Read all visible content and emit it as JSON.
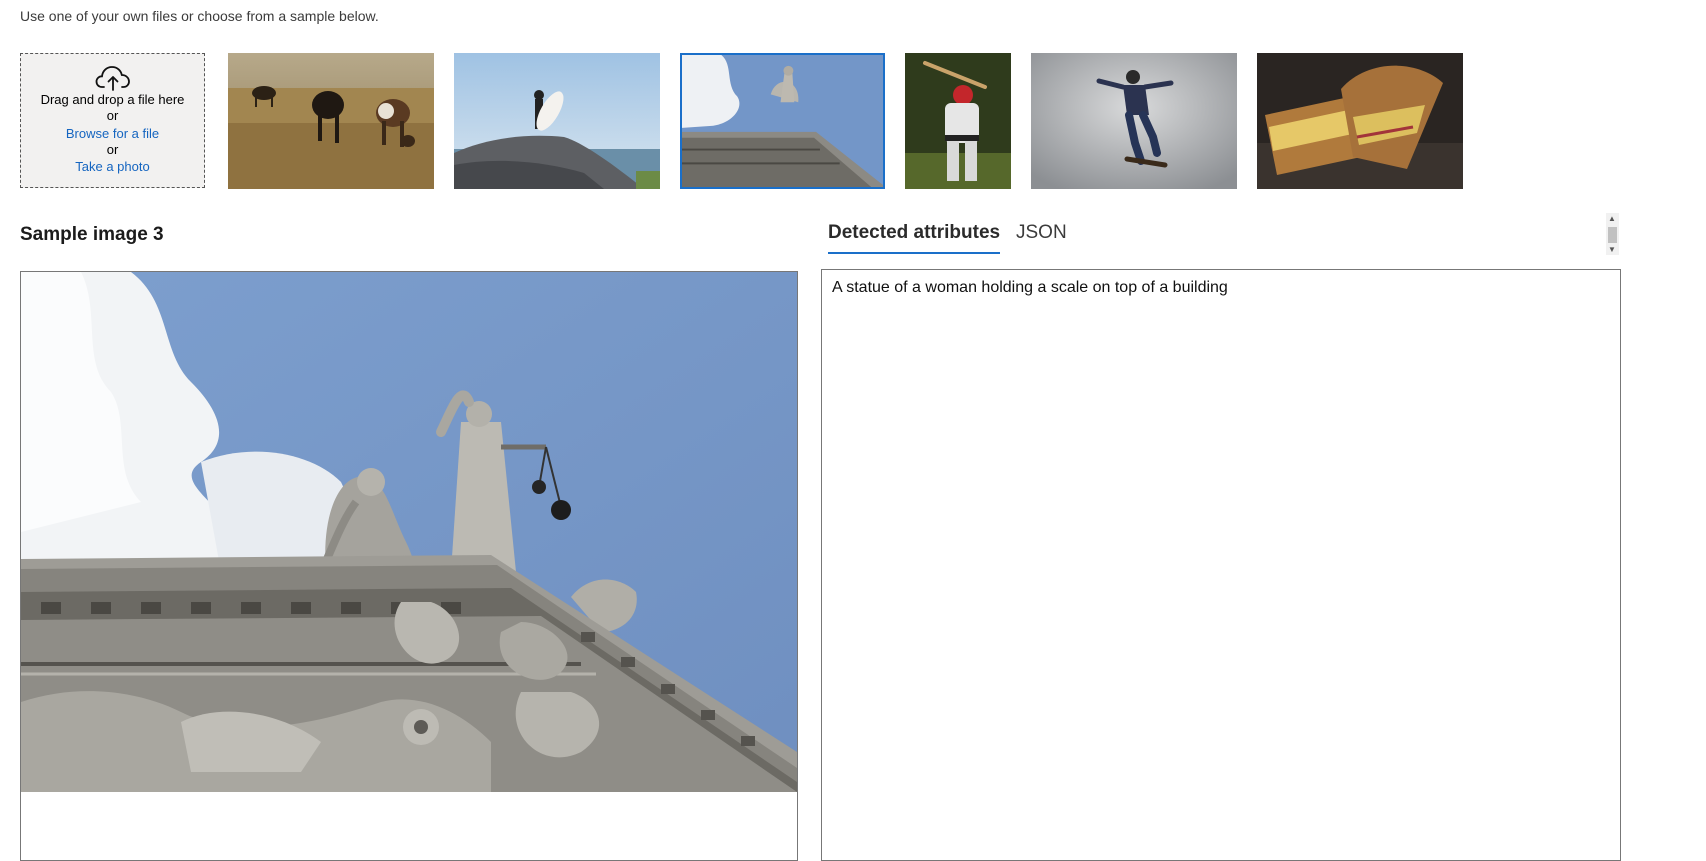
{
  "intro_text": "Use one of your own files or choose from a sample below.",
  "upload": {
    "drag_text": "Drag and drop a file here",
    "or_1": "or",
    "browse_link": "Browse for a file",
    "or_2": "or",
    "photo_link": "Take a photo",
    "icon": "cloud-upload-icon"
  },
  "samples": [
    {
      "id": "sample-1",
      "subject": "cows grazing in a field"
    },
    {
      "id": "sample-2",
      "subject": "surfer on a rock by the sea"
    },
    {
      "id": "sample-3",
      "subject": "statues on top of a building",
      "selected": true
    },
    {
      "id": "sample-4",
      "subject": "baseball batter"
    },
    {
      "id": "sample-5",
      "subject": "skateboarder jumping"
    },
    {
      "id": "sample-6",
      "subject": "grilled sandwich"
    }
  ],
  "sample_title": "Sample image 3",
  "tabs": [
    {
      "label": "Detected attributes",
      "active": true
    },
    {
      "label": "JSON",
      "active": false
    }
  ],
  "result": {
    "caption": "A statue of a woman holding a scale on top of a building"
  },
  "colors": {
    "accent": "#1a6fc9",
    "link": "#1565c0"
  }
}
